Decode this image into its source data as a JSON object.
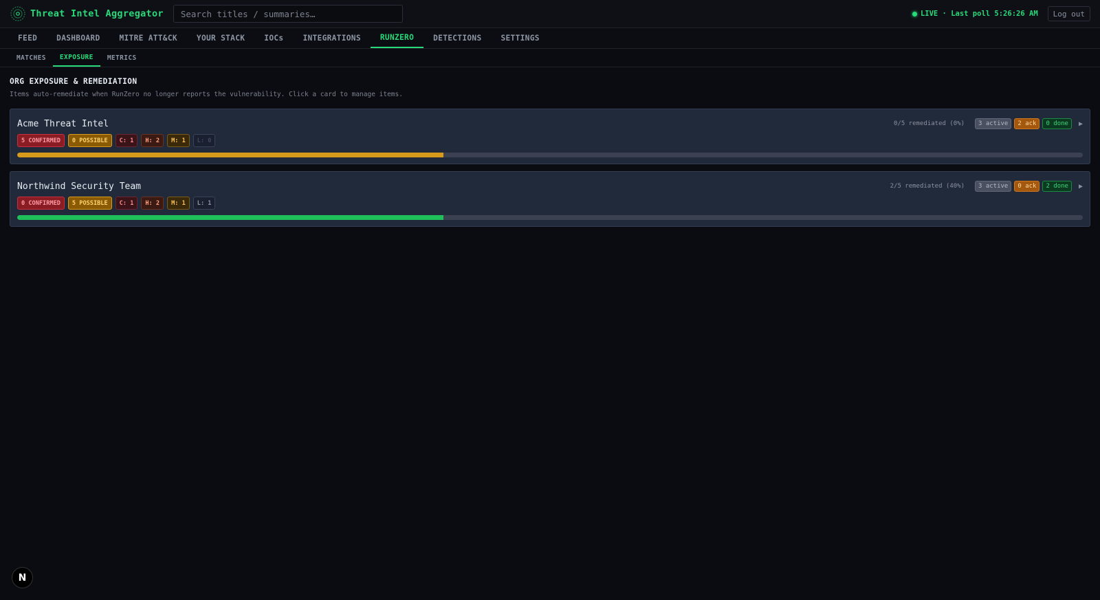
{
  "app": {
    "title": "Threat Intel Aggregator",
    "logo_icon": "radar-icon"
  },
  "search": {
    "placeholder": "Search titles / summaries…",
    "value": ""
  },
  "status": {
    "live_text": "LIVE · Last poll 5:26:26 AM",
    "color": "#28d97a"
  },
  "header": {
    "logout_label": "Log out"
  },
  "main_nav": {
    "tabs": [
      {
        "label": "FEED",
        "active": false
      },
      {
        "label": "DASHBOARD",
        "active": false
      },
      {
        "label": "MITRE ATT&CK",
        "active": false
      },
      {
        "label": "YOUR STACK",
        "active": false
      },
      {
        "label": "IOCs",
        "active": false
      },
      {
        "label": "INTEGRATIONS",
        "active": false
      },
      {
        "label": "RUNZERO",
        "active": true
      },
      {
        "label": "DETECTIONS",
        "active": false
      },
      {
        "label": "SETTINGS",
        "active": false
      }
    ]
  },
  "sub_nav": {
    "tabs": [
      {
        "label": "MATCHES",
        "active": false
      },
      {
        "label": "EXPOSURE",
        "active": true
      },
      {
        "label": "METRICS",
        "active": false
      }
    ]
  },
  "section": {
    "title": "ORG EXPOSURE & REMEDIATION",
    "description": "Items auto-remediate when RunZero no longer reports the vulnerability. Click a card to manage items."
  },
  "orgs": [
    {
      "name": "Acme Threat Intel",
      "remediated_text": "0/5 remediated (0%)",
      "active_chip": "3 active",
      "ack_chip": "2 ack",
      "done_chip": "0 done",
      "confirmed": "5 CONFIRMED",
      "possible": "0 POSSIBLE",
      "critical": "C: 1",
      "high": "H: 2",
      "medium": "M: 1",
      "low": "L: 0",
      "progress_fraction": 0.4,
      "progress_color": "#d89a1a",
      "expand_icon": "chevron-right-icon"
    },
    {
      "name": "Northwind Security Team",
      "remediated_text": "2/5 remediated (40%)",
      "active_chip": "3 active",
      "ack_chip": "0 ack",
      "done_chip": "2 done",
      "confirmed": "0 CONFIRMED",
      "possible": "5 POSSIBLE",
      "critical": "C: 1",
      "high": "H: 2",
      "medium": "M: 1",
      "low": "L: 1",
      "progress_fraction": 0.4,
      "progress_color": "#1fbf5a",
      "expand_icon": "chevron-right-icon"
    }
  ],
  "dev_badge": {
    "label": "N",
    "icon": "nextjs-icon"
  }
}
